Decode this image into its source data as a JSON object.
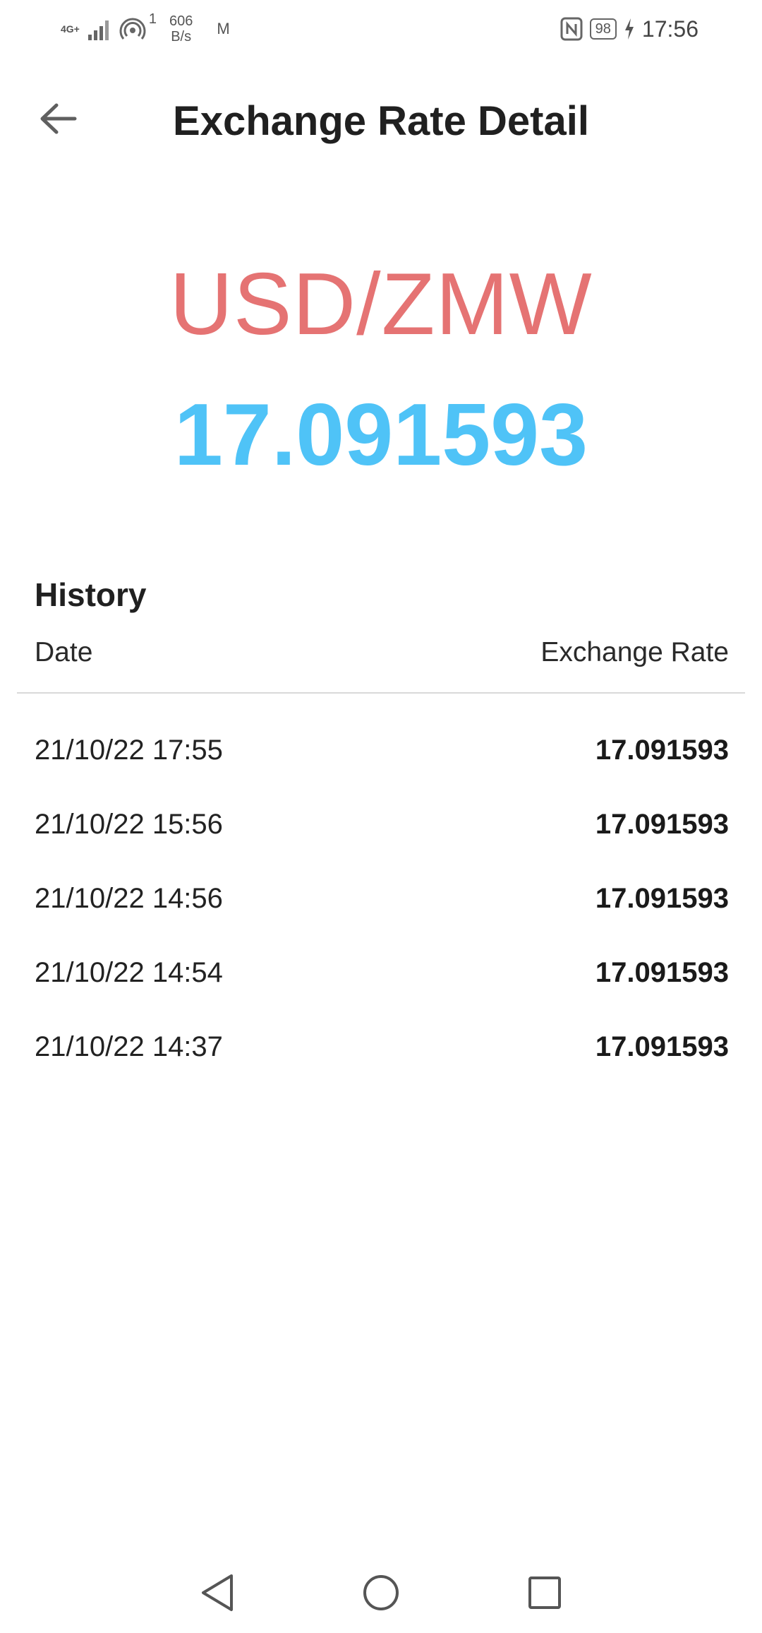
{
  "status_bar": {
    "network": "4G+",
    "wifi_sub": "1",
    "speed_value": "606",
    "speed_unit": "B/s",
    "carrier": "M",
    "battery": "98",
    "time": "17:56"
  },
  "app_bar": {
    "title": "Exchange Rate Detail"
  },
  "rate_display": {
    "pair": "USD/ZMW",
    "value": "17.091593"
  },
  "history": {
    "title": "History",
    "columns": {
      "date": "Date",
      "rate": "Exchange Rate"
    },
    "rows": [
      {
        "date": "21/10/22 17:55",
        "rate": "17.091593"
      },
      {
        "date": "21/10/22 15:56",
        "rate": "17.091593"
      },
      {
        "date": "21/10/22 14:56",
        "rate": "17.091593"
      },
      {
        "date": "21/10/22 14:54",
        "rate": "17.091593"
      },
      {
        "date": "21/10/22 14:37",
        "rate": "17.091593"
      }
    ]
  },
  "colors": {
    "pair": "#e57373",
    "rate": "#4fc3f7"
  }
}
